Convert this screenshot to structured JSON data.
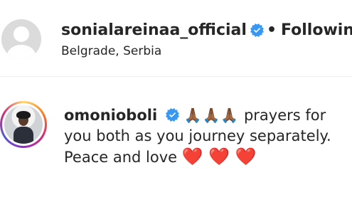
{
  "post_header": {
    "username": "sonialareinaa_official",
    "separator": "•",
    "follow_status": "Following",
    "location": "Belgrade, Serbia",
    "verified_icon": "verified-badge-icon",
    "avatar_icon": "default-avatar-icon"
  },
  "comment": {
    "username": "omonioboli",
    "verified_icon": "verified-badge-icon",
    "emoji_prefix": "🙏🏾🙏🏾🙏🏾",
    "text": " prayers for you both as you journey separately. Peace and love ",
    "emoji_suffix": "❤️ ❤️ ❤️"
  },
  "colors": {
    "verified": "#3897f0",
    "text": "#262626",
    "heart": "#e0162b",
    "divider": "#efefef"
  }
}
